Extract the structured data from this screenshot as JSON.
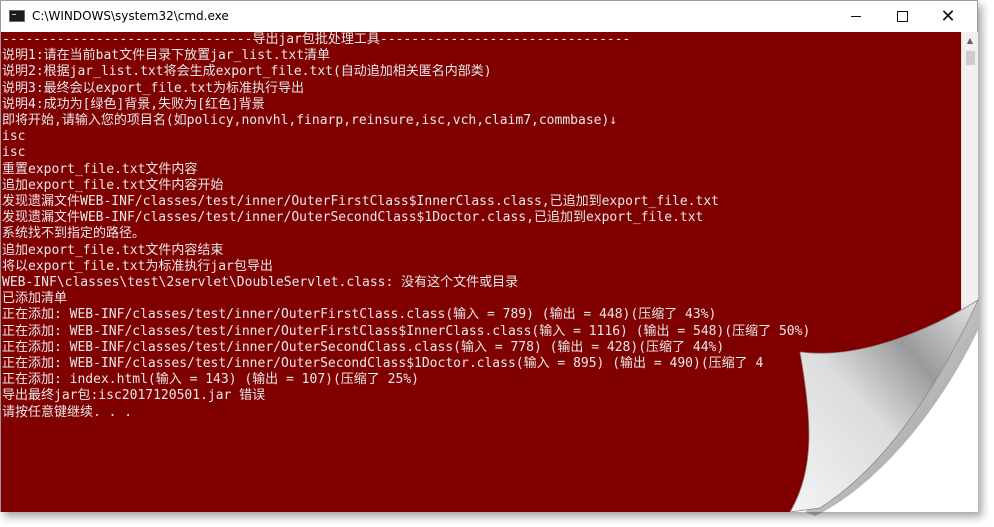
{
  "window": {
    "title": "C:\\WINDOWS\\system32\\cmd.exe",
    "controls": {
      "minimize": "minimize",
      "maximize": "maximize",
      "close": "✕"
    }
  },
  "console": {
    "background": "#800000",
    "foreground": "#e8e8e8",
    "lines": [
      "--------------------------------导出jar包批处理工具--------------------------------",
      "说明1:请在当前bat文件目录下放置jar_list.txt清单",
      "说明2:根据jar_list.txt将会生成export_file.txt(自动追加相关匿名内部类)",
      "说明3:最终会以export_file.txt为标准执行导出",
      "说明4:成功为[绿色]背景,失败为[红色]背景",
      "即将开始,请输入您的项目名(如policy,nonvhl,finarp,reinsure,isc,vch,claim7,commbase)↓",
      "isc",
      "isc",
      "重置export_file.txt文件内容",
      "追加export_file.txt文件内容开始",
      "发现遗漏文件WEB-INF/classes/test/inner/OuterFirstClass$InnerClass.class,已追加到export_file.txt",
      "发现遗漏文件WEB-INF/classes/test/inner/OuterSecondClass$1Doctor.class,已追加到export_file.txt",
      "系统找不到指定的路径。",
      "追加export_file.txt文件内容结束",
      "将以export_file.txt为标准执行jar包导出",
      "WEB-INF\\classes\\test\\2servlet\\DoubleServlet.class: 没有这个文件或目录",
      "已添加清单",
      "正在添加: WEB-INF/classes/test/inner/OuterFirstClass.class(输入 = 789) (输出 = 448)(压缩了 43%)",
      "正在添加: WEB-INF/classes/test/inner/OuterFirstClass$InnerClass.class(输入 = 1116) (输出 = 548)(压缩了 50%)",
      "正在添加: WEB-INF/classes/test/inner/OuterSecondClass.class(输入 = 778) (输出 = 428)(压缩了 44%)",
      "正在添加: WEB-INF/classes/test/inner/OuterSecondClass$1Doctor.class(输入 = 895) (输出 = 490)(压缩了 4",
      "正在添加: index.html(输入 = 143) (输出 = 107)(压缩了 25%)",
      "导出最终jar包:isc2017120501.jar 错误",
      "请按任意键继续. . ."
    ]
  },
  "scrollbar": {
    "up_arrow": "▲"
  },
  "icons": {
    "app": "cmd-app-icon",
    "minimize": "minimize-icon",
    "maximize": "maximize-icon",
    "close": "close-icon",
    "scroll_up": "scroll-up-arrow-icon"
  }
}
